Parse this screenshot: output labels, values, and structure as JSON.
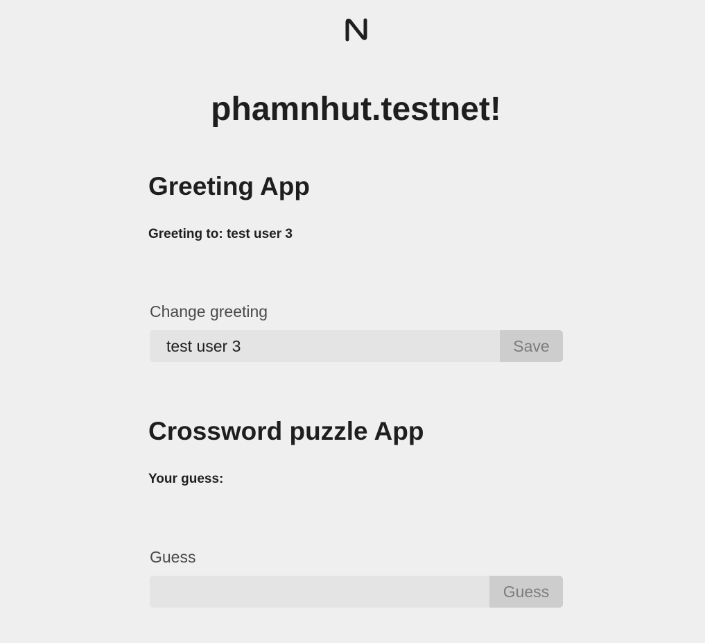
{
  "header": {
    "logo_icon": "near-logo-icon",
    "title": "phamnhut.testnet!"
  },
  "greeting_app": {
    "title": "Greeting App",
    "greeting_status": "Greeting to: test user 3",
    "change_label": "Change greeting",
    "input_value": "test user 3",
    "save_label": "Save"
  },
  "crossword_app": {
    "title": "Crossword puzzle App",
    "guess_status": "Your guess:",
    "guess_label": "Guess",
    "input_value": "",
    "guess_button_label": "Guess"
  },
  "colors": {
    "background": "#efefef",
    "text": "#1e1e1e",
    "input_bg": "#e4e4e4",
    "button_bg": "#cdcdcd",
    "button_text": "#7d7d7d"
  }
}
